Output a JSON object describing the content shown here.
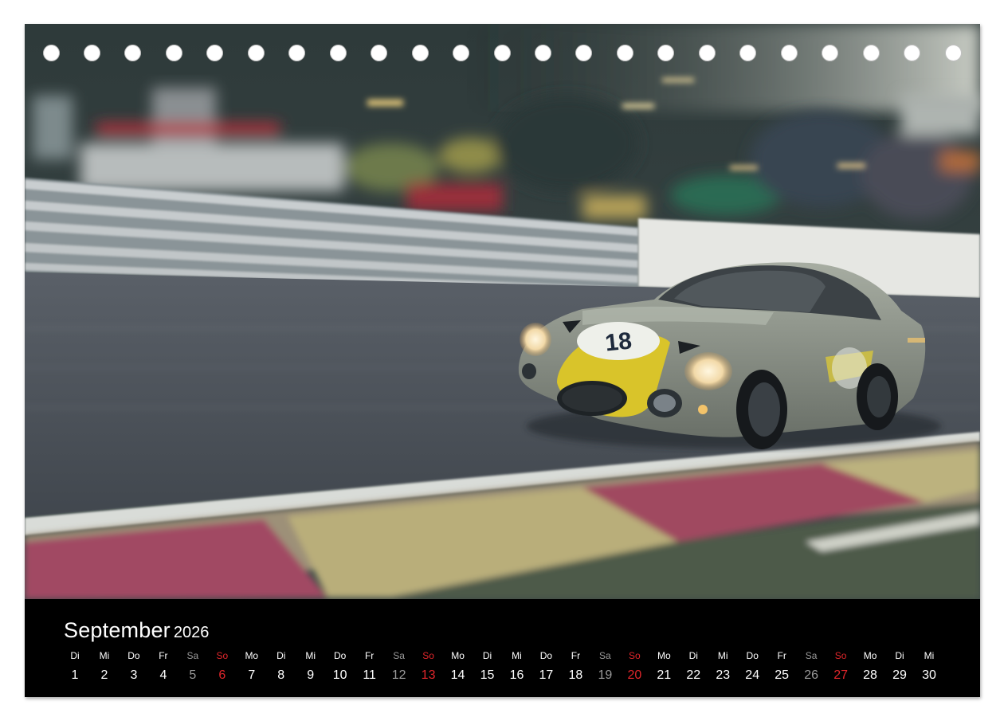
{
  "calendar": {
    "month": "September",
    "year": "2026",
    "days": [
      {
        "weekday": "Di",
        "date": "1",
        "type": "weekday"
      },
      {
        "weekday": "Mi",
        "date": "2",
        "type": "weekday"
      },
      {
        "weekday": "Do",
        "date": "3",
        "type": "weekday"
      },
      {
        "weekday": "Fr",
        "date": "4",
        "type": "weekday"
      },
      {
        "weekday": "Sa",
        "date": "5",
        "type": "sat"
      },
      {
        "weekday": "So",
        "date": "6",
        "type": "sun"
      },
      {
        "weekday": "Mo",
        "date": "7",
        "type": "weekday"
      },
      {
        "weekday": "Di",
        "date": "8",
        "type": "weekday"
      },
      {
        "weekday": "Mi",
        "date": "9",
        "type": "weekday"
      },
      {
        "weekday": "Do",
        "date": "10",
        "type": "weekday"
      },
      {
        "weekday": "Fr",
        "date": "11",
        "type": "weekday"
      },
      {
        "weekday": "Sa",
        "date": "12",
        "type": "sat"
      },
      {
        "weekday": "So",
        "date": "13",
        "type": "sun"
      },
      {
        "weekday": "Mo",
        "date": "14",
        "type": "weekday"
      },
      {
        "weekday": "Di",
        "date": "15",
        "type": "weekday"
      },
      {
        "weekday": "Mi",
        "date": "16",
        "type": "weekday"
      },
      {
        "weekday": "Do",
        "date": "17",
        "type": "weekday"
      },
      {
        "weekday": "Fr",
        "date": "18",
        "type": "weekday"
      },
      {
        "weekday": "Sa",
        "date": "19",
        "type": "sat"
      },
      {
        "weekday": "So",
        "date": "20",
        "type": "sun"
      },
      {
        "weekday": "Mo",
        "date": "21",
        "type": "weekday"
      },
      {
        "weekday": "Di",
        "date": "22",
        "type": "weekday"
      },
      {
        "weekday": "Mi",
        "date": "23",
        "type": "weekday"
      },
      {
        "weekday": "Do",
        "date": "24",
        "type": "weekday"
      },
      {
        "weekday": "Fr",
        "date": "25",
        "type": "weekday"
      },
      {
        "weekday": "Sa",
        "date": "26",
        "type": "sat"
      },
      {
        "weekday": "So",
        "date": "27",
        "type": "sun"
      },
      {
        "weekday": "Mo",
        "date": "28",
        "type": "weekday"
      },
      {
        "weekday": "Di",
        "date": "29",
        "type": "weekday"
      },
      {
        "weekday": "Mi",
        "date": "30",
        "type": "weekday"
      }
    ]
  },
  "photo": {
    "car_number": "18",
    "colors": {
      "car_body": "#8c9388",
      "car_stripe": "#d9c42a",
      "track": "#4b5158",
      "curb_red": "#a04860",
      "curb_yellow": "#b9ae7a",
      "sunday_red": "#e0262b"
    }
  },
  "binding_holes": 23
}
